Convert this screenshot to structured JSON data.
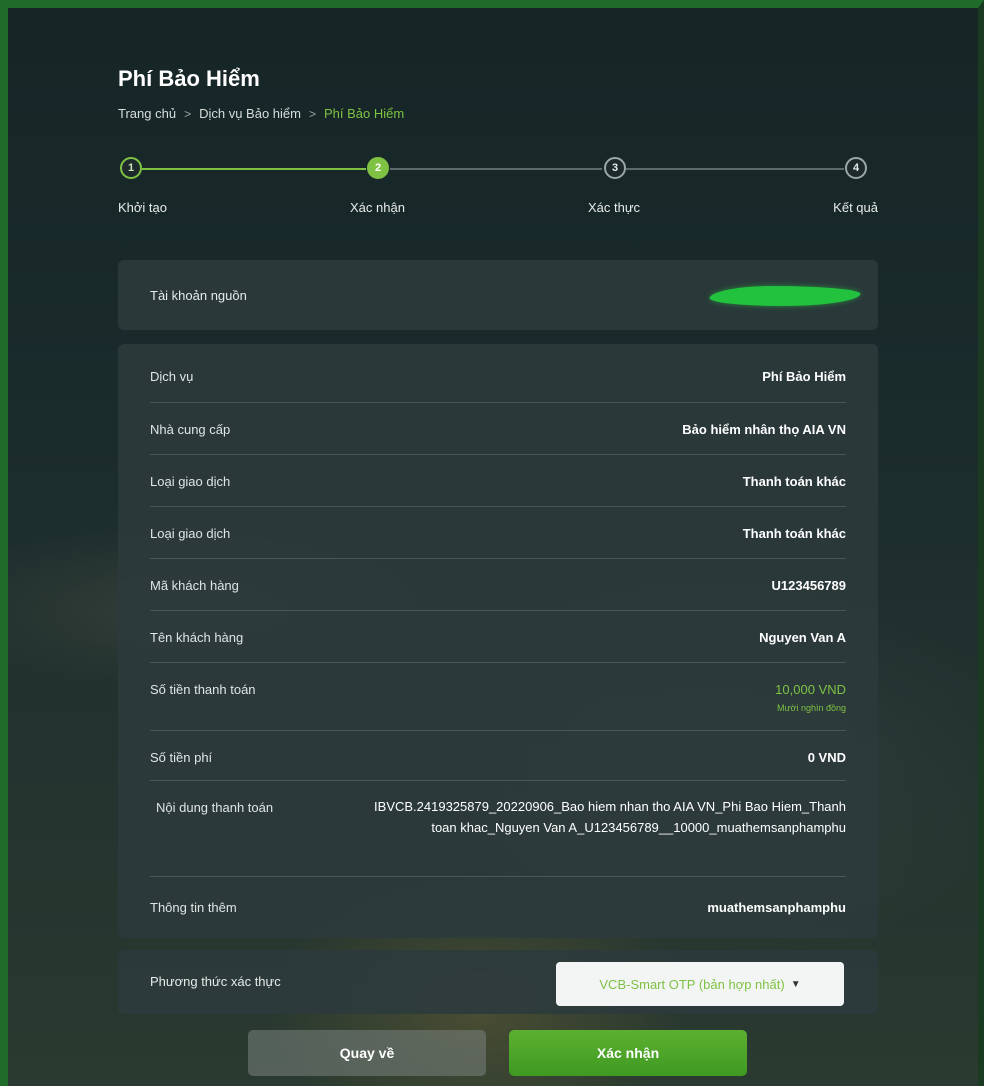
{
  "page": {
    "title": "Phí Bảo Hiểm",
    "breadcrumb": [
      "Trang chủ",
      "Dịch vụ Bảo hiểm",
      "Phí Bảo Hiểm"
    ],
    "breadcrumb_separator": ">"
  },
  "stepper": {
    "steps": [
      {
        "number": "1",
        "label": "Khởi tạo",
        "state": "done"
      },
      {
        "number": "2",
        "label": "Xác nhận",
        "state": "active"
      },
      {
        "number": "3",
        "label": "Xác thực",
        "state": "todo"
      },
      {
        "number": "4",
        "label": "Kết quả",
        "state": "todo"
      }
    ]
  },
  "source_account": {
    "label": "Tài khoản nguồn"
  },
  "details": [
    {
      "label": "Dịch vụ",
      "value": "Phí Bảo Hiểm"
    },
    {
      "label": "Nhà cung cấp",
      "value": "Bảo hiểm nhân thọ AIA VN"
    },
    {
      "label": "Loại giao dịch",
      "value": "Thanh toán khác"
    },
    {
      "label": "Loại giao dịch",
      "value": "Thanh toán khác"
    },
    {
      "label": "Mã khách hàng",
      "value": "U123456789"
    },
    {
      "label": "Tên khách hàng",
      "value": "Nguyen Van A"
    },
    {
      "label": "Số tiền thanh toán",
      "value": "10,000 VND",
      "sub": "Mười nghìn đồng"
    },
    {
      "label": "Số tiền phí",
      "value": "0 VND"
    },
    {
      "label": "Nội dung thanh toán",
      "value": "IBVCB.2419325879_20220906_Bao hiem nhan tho AIA VN_Phi Bao Hiem_Thanh toan khac_Nguyen Van A_U123456789__10000_muathemsanphamphu"
    },
    {
      "label": "Thông tin thêm",
      "value": "muathemsanphamphu"
    }
  ],
  "auth": {
    "label": "Phương thức xác thực",
    "selected": "VCB-Smart OTP (bản hợp nhất)"
  },
  "buttons": {
    "back": "Quay về",
    "confirm": "Xác nhận"
  },
  "colors": {
    "accent": "#7fc243",
    "confirm_button": "#4aa428"
  }
}
